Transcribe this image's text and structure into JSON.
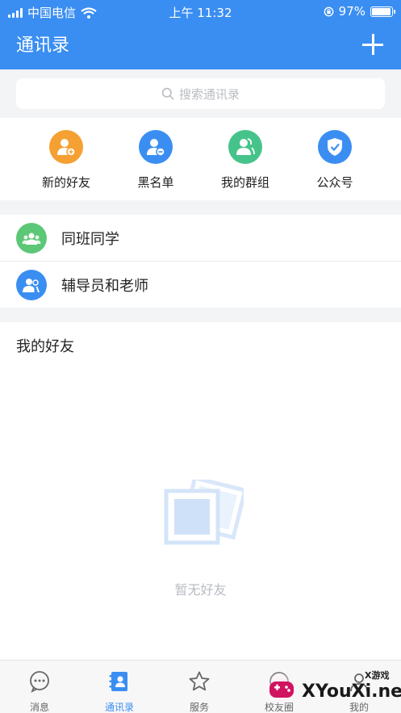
{
  "status_bar": {
    "carrier": "中国电信",
    "time": "上午 11:32",
    "battery": "97%",
    "battery_level": 0.97
  },
  "nav": {
    "title": "通讯录"
  },
  "search": {
    "placeholder": "搜索通讯录"
  },
  "quick_actions": [
    {
      "label": "新的好友",
      "color": "#f5a033",
      "icon": "add-user-icon"
    },
    {
      "label": "黑名单",
      "color": "#3a8ef2",
      "icon": "remove-user-icon"
    },
    {
      "label": "我的群组",
      "color": "#46c38a",
      "icon": "group-user-icon"
    },
    {
      "label": "公众号",
      "color": "#3a8ef2",
      "icon": "verified-shield-icon"
    }
  ],
  "groups": [
    {
      "label": "同班同学",
      "color": "#5cc776",
      "icon": "classmates-icon"
    },
    {
      "label": "辅导员和老师",
      "color": "#3a8ef2",
      "icon": "teachers-icon"
    }
  ],
  "friends": {
    "title": "我的好友",
    "empty_text": "暂无好友"
  },
  "tabs": [
    {
      "label": "消息",
      "icon": "chat-bubble-icon",
      "active": false
    },
    {
      "label": "通讯录",
      "icon": "contacts-icon",
      "active": true
    },
    {
      "label": "服务",
      "icon": "star-icon",
      "active": false
    },
    {
      "label": "校友圈",
      "icon": "moments-icon",
      "active": false
    },
    {
      "label": "我的",
      "icon": "profile-icon",
      "active": false
    }
  ],
  "watermark": {
    "text": "XYouXi.net",
    "small": "X游戏"
  },
  "colors": {
    "primary": "#3a8ef2",
    "background": "#f3f4f6"
  }
}
